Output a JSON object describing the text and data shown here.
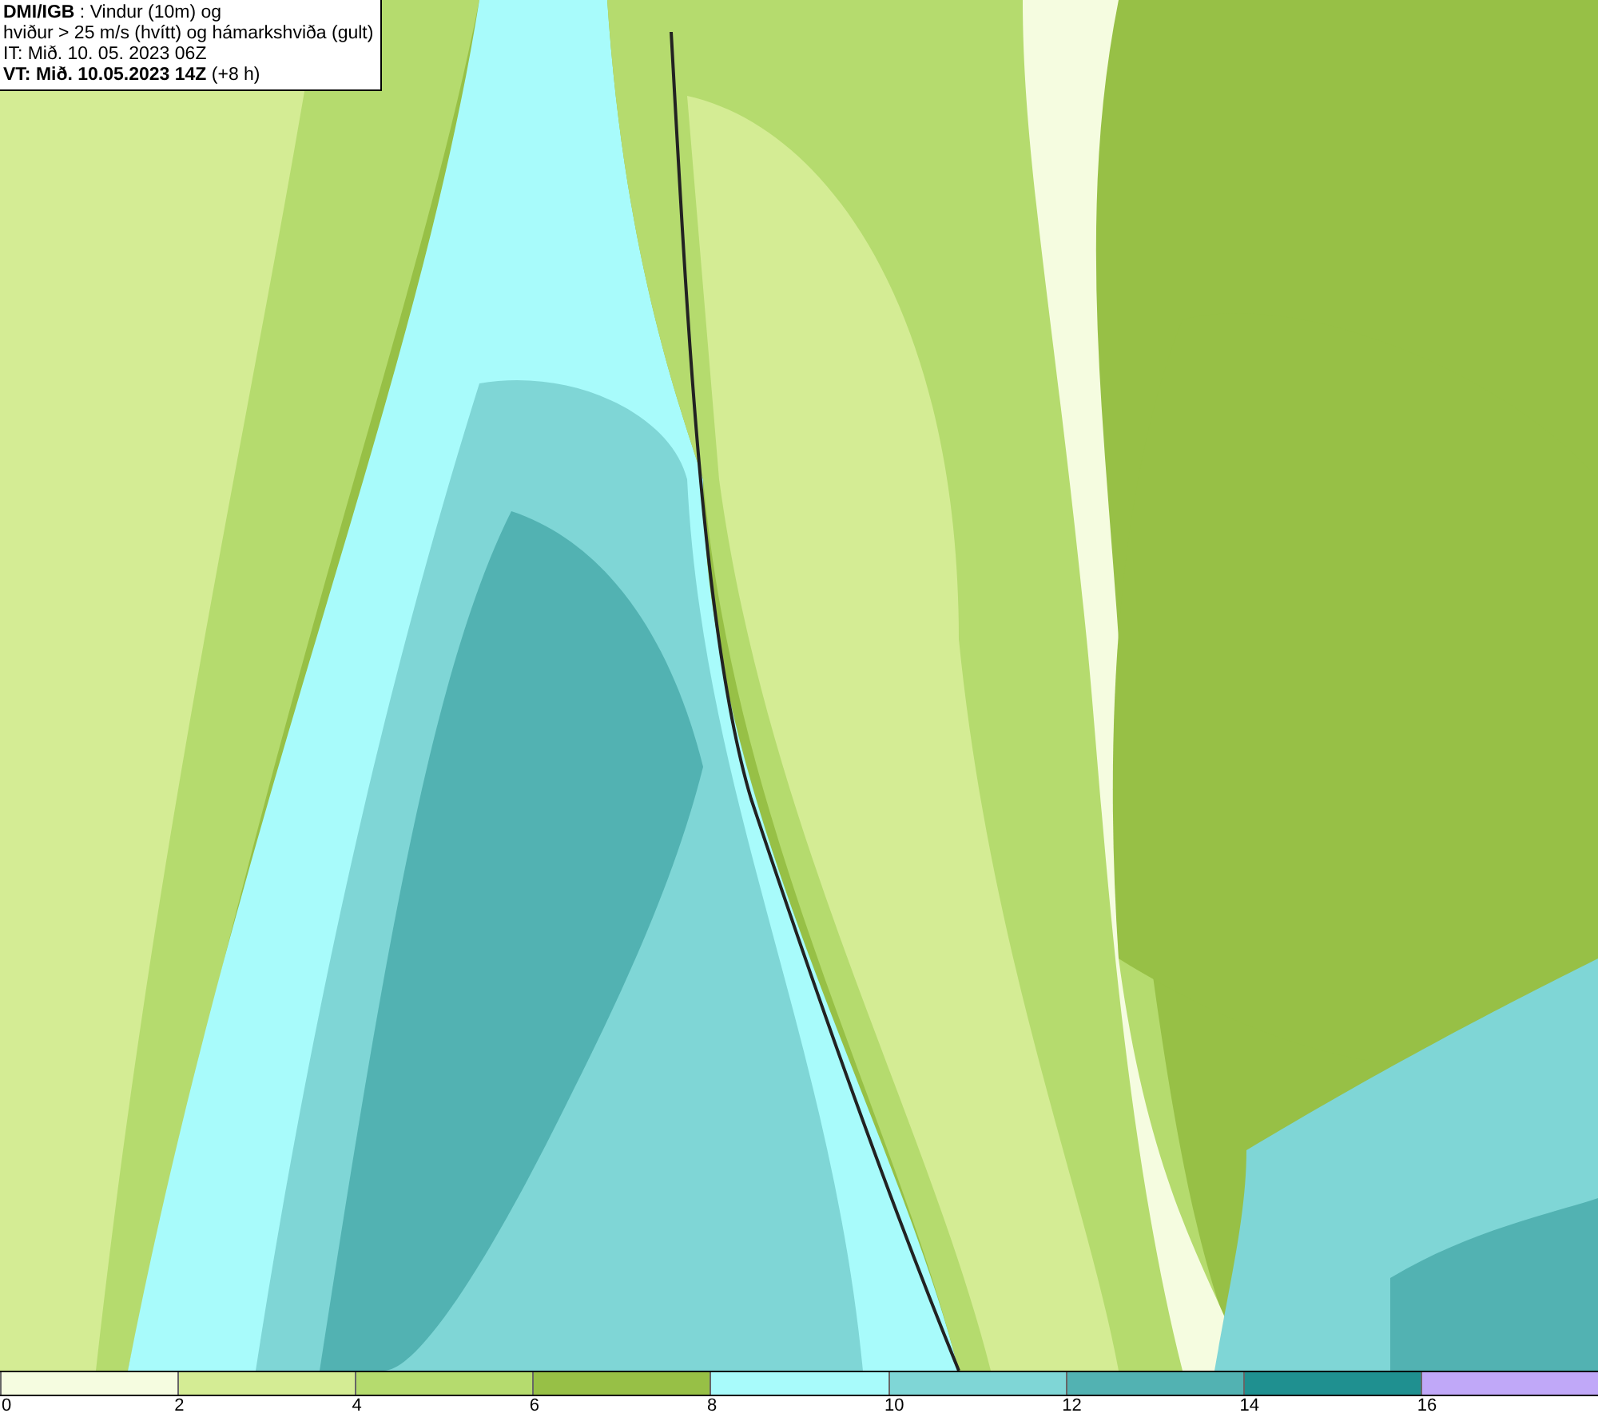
{
  "header": {
    "lines": [
      "**DMI/IGB** : Vindur (10m) og",
      "hviður > 25 m/s (hvítt) og hámarkshviða (gult)",
      "IT: Mið. 10. 05. 2023 06Z",
      "**VT: Mið. 10.05.2023 14Z** (+8 h)"
    ]
  },
  "legend": {
    "bins": [
      {
        "color": "#f5fce0",
        "tick": "0"
      },
      {
        "color": "#d4ec94",
        "tick": "2"
      },
      {
        "color": "#b5db6e",
        "tick": "4"
      },
      {
        "color": "#97c046",
        "tick": "6"
      },
      {
        "color": "#a8fbfb",
        "tick": "8"
      },
      {
        "color": "#7fd6d6",
        "tick": "10"
      },
      {
        "color": "#52b2b2",
        "tick": "12"
      },
      {
        "color": "#1f9090",
        "tick": "14"
      },
      {
        "color": "#c0a8f8",
        "tick": "16"
      }
    ]
  }
}
